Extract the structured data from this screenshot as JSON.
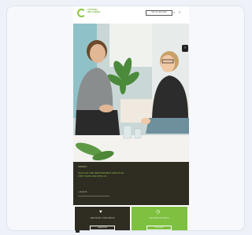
{
  "header": {
    "logo_line1": "COUNSEL",
    "logo_line2": "WELLBEING",
    "language_button": "SWITCH LANGUAGE",
    "icon_menu": "menu-icon",
    "icon_search": "search-icon"
  },
  "hero": {
    "image_alt_icon": "therapy-session-photo",
    "side_button_icon": "expand-icon",
    "side_button": "›"
  },
  "panel": {
    "line1": "VISION /",
    "line2": "SUCH AS THE NEW PROJECT AND PLAN FOR YOUR LIFE WITH US",
    "line3": "+ 45 22 33"
  },
  "cards": [
    {
      "icon": "heart-icon",
      "icon_glyph": "♥",
      "text": "FREE INITIAL CONSULTATION",
      "button": "LEARN MORE"
    },
    {
      "icon": "clock-icon",
      "icon_glyph": "◷",
      "text": "ONLINE APPOINTMENTS",
      "button": "BOOK NOW"
    }
  ],
  "colors": {
    "accent": "#8bc34a",
    "dark": "#2f2c22",
    "card_green": "#7ec040"
  }
}
